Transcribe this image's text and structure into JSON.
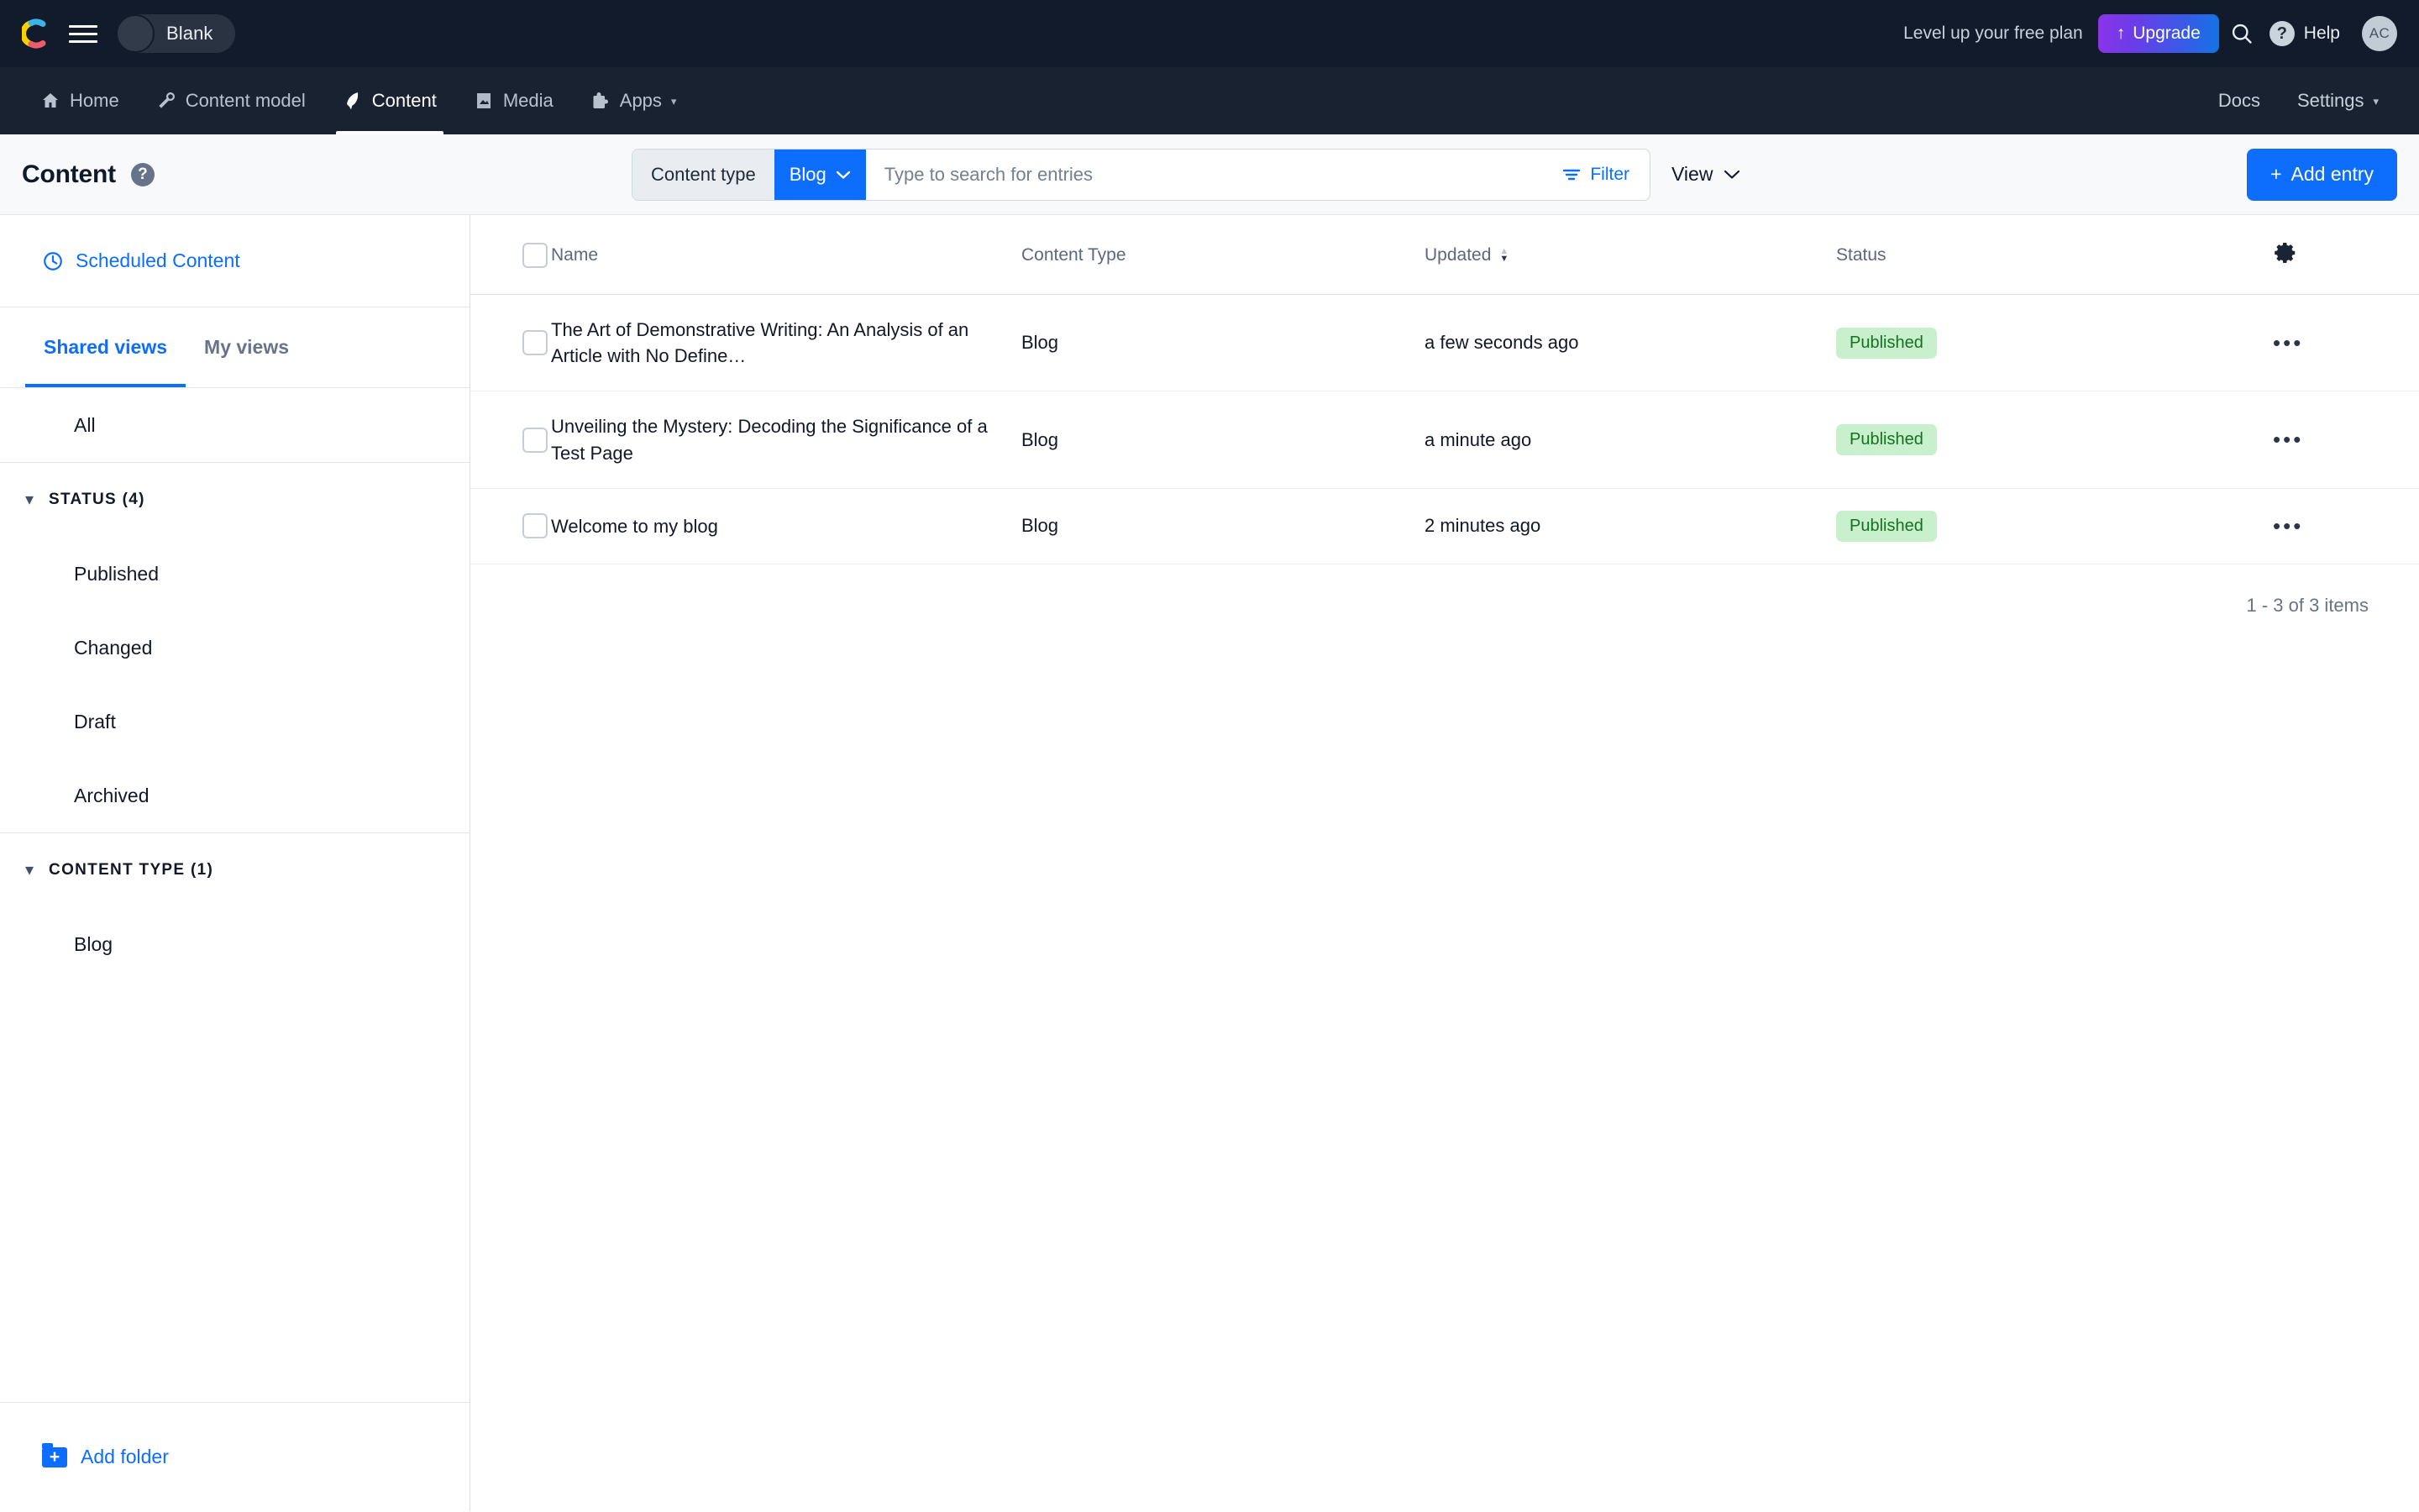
{
  "topbar": {
    "logo_icon": "contentful-logo-icon",
    "menu_icon": "hamburger-menu-icon",
    "space_name": "Blank",
    "level_text": "Level up your free plan",
    "upgrade_label": "Upgrade",
    "upgrade_icon": "arrow-up-icon",
    "search_icon": "search-icon",
    "help_icon": "question-mark-icon",
    "help_label": "Help",
    "avatar_initials": "AC",
    "colors": {
      "bg": "#111b2b",
      "upgrade_from": "#8b35e8",
      "upgrade_to": "#1273e6"
    }
  },
  "nav": {
    "items": [
      {
        "label": "Home",
        "icon": "home-icon",
        "active": false
      },
      {
        "label": "Content model",
        "icon": "wrench-icon",
        "active": false
      },
      {
        "label": "Content",
        "icon": "pen-nib-icon",
        "active": true
      },
      {
        "label": "Media",
        "icon": "image-icon",
        "active": false
      },
      {
        "label": "Apps",
        "icon": "puzzle-icon",
        "active": false,
        "caret": true
      }
    ],
    "right": [
      {
        "label": "Docs",
        "caret": false
      },
      {
        "label": "Settings",
        "caret": true
      }
    ],
    "caret_glyph": "▾",
    "bg": "#192231"
  },
  "subheader": {
    "title": "Content",
    "help_glyph": "?",
    "content_type_label": "Content type",
    "content_type_value": "Blog",
    "chevron_glyph": "∨",
    "search_placeholder": "Type to search for entries",
    "search_value": "",
    "filter_label": "Filter",
    "filter_icon": "filter-icon",
    "view_label": "View",
    "add_entry_label": "Add entry",
    "add_entry_plus": "+",
    "accent": "#0d6efd"
  },
  "sidebar": {
    "scheduled_label": "Scheduled Content",
    "clock_icon": "clock-icon",
    "tabs": [
      {
        "label": "Shared views",
        "active": true
      },
      {
        "label": "My views",
        "active": false
      }
    ],
    "all_label": "All",
    "groups": [
      {
        "title": "STATUS (4)",
        "expanded": true,
        "items": [
          {
            "label": "Published"
          },
          {
            "label": "Changed"
          },
          {
            "label": "Draft"
          },
          {
            "label": "Archived"
          }
        ]
      },
      {
        "title": "CONTENT TYPE (1)",
        "expanded": true,
        "items": [
          {
            "label": "Blog"
          }
        ]
      }
    ],
    "add_folder_label": "Add folder",
    "folder_icon": "folder-plus-icon"
  },
  "table": {
    "columns": [
      {
        "key": "name",
        "label": "Name"
      },
      {
        "key": "type",
        "label": "Content Type"
      },
      {
        "key": "updated",
        "label": "Updated",
        "sorted": "desc"
      },
      {
        "key": "status",
        "label": "Status"
      }
    ],
    "settings_icon": "gear-icon",
    "row_menu_glyph": "•••",
    "rows": [
      {
        "name": "The Art of Demonstrative Writing: An Analysis of an Article with No Define…",
        "type": "Blog",
        "updated": "a few seconds ago",
        "status": "Published"
      },
      {
        "name": "Unveiling the Mystery: Decoding the Significance of a Test Page",
        "type": "Blog",
        "updated": "a minute ago",
        "status": "Published"
      },
      {
        "name": "Welcome to my blog",
        "type": "Blog",
        "updated": "2 minutes ago",
        "status": "Published"
      }
    ],
    "pagination": "1 - 3 of 3 items",
    "status_colors": {
      "published_bg": "#c8f0cd",
      "published_fg": "#16711f"
    }
  }
}
